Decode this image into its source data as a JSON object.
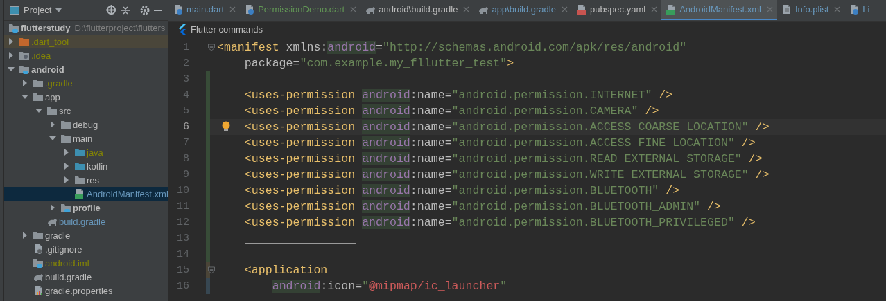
{
  "project_panel": {
    "title": "Project",
    "root": {
      "name": "flutterstudy",
      "path": "D:\\flutterproject\\flutters"
    },
    "tree": [
      {
        "name": ".dart_tool",
        "kind": "excluded-folder",
        "color": "#848504",
        "expanded": false,
        "excluded": true
      },
      {
        "name": ".idea",
        "kind": "idea-folder",
        "color": "#848504",
        "expanded": false,
        "excluded": false
      },
      {
        "name": "android",
        "kind": "module-folder",
        "color": "#bbbbbb",
        "bold": true,
        "expanded": true,
        "children": [
          {
            "name": ".gradle",
            "kind": "folder",
            "color": "#848504",
            "expanded": false
          },
          {
            "name": "app",
            "kind": "folder",
            "color": "#bbbbbb",
            "expanded": true,
            "children": [
              {
                "name": "src",
                "kind": "folder",
                "color": "#bbbbbb",
                "expanded": true,
                "children": [
                  {
                    "name": "debug",
                    "kind": "folder",
                    "color": "#bbbbbb",
                    "expanded": false
                  },
                  {
                    "name": "main",
                    "kind": "folder",
                    "color": "#bbbbbb",
                    "expanded": true,
                    "children": [
                      {
                        "name": "java",
                        "kind": "source-folder",
                        "color": "#848504",
                        "expanded": false
                      },
                      {
                        "name": "kotlin",
                        "kind": "source-folder",
                        "color": "#bbbbbb",
                        "expanded": false
                      },
                      {
                        "name": "res",
                        "kind": "folder",
                        "color": "#bbbbbb",
                        "expanded": false
                      },
                      {
                        "name": "AndroidManifest.xml",
                        "kind": "manifest",
                        "color": "#6897bb",
                        "selected": true
                      }
                    ]
                  },
                  {
                    "name": "profile",
                    "kind": "module-folder",
                    "color": "#bbbbbb",
                    "bold": true,
                    "expanded": false
                  }
                ]
              },
              {
                "name": "build.gradle",
                "kind": "gradle",
                "color": "#6897bb",
                "selected": false
              }
            ]
          },
          {
            "name": "gradle",
            "kind": "folder",
            "color": "#bbbbbb",
            "expanded": false
          },
          {
            "name": ".gitignore",
            "kind": "gitignore",
            "color": "#bbbbbb",
            "selected": false
          },
          {
            "name": "android.iml",
            "kind": "iml",
            "color": "#848504",
            "selected": false
          },
          {
            "name": "build.gradle",
            "kind": "gradle",
            "color": "#bbbbbb",
            "selected": false
          },
          {
            "name": "gradle.properties",
            "kind": "properties",
            "color": "#bbbbbb",
            "selected": false
          }
        ]
      }
    ]
  },
  "tabs": [
    {
      "label": "main.dart",
      "kind": "dart",
      "color": "#6897bb",
      "selected": false,
      "closable": true
    },
    {
      "label": "PermissionDemo.dart",
      "kind": "dart",
      "color": "#629755",
      "selected": false,
      "closable": true
    },
    {
      "label": "android\\build.gradle",
      "kind": "gradle",
      "color": "#bbbbbb",
      "selected": false,
      "closable": true
    },
    {
      "label": "app\\build.gradle",
      "kind": "gradle",
      "color": "#6897bb",
      "selected": false,
      "closable": true
    },
    {
      "label": "pubspec.yaml",
      "kind": "yaml",
      "color": "#bbbbbb",
      "selected": false,
      "closable": true
    },
    {
      "label": "AndroidManifest.xml",
      "kind": "manifest",
      "color": "#6897bb",
      "selected": true,
      "closable": true
    },
    {
      "label": "Info.plist",
      "kind": "plist",
      "color": "#6897bb",
      "selected": false,
      "closable": true
    },
    {
      "label": "Li",
      "kind": "dart",
      "color": "#6897bb",
      "selected": false,
      "closable": false
    }
  ],
  "editor_toolbar": {
    "label": "Flutter commands"
  },
  "code_lines": [
    {
      "number": "1",
      "fold": true,
      "tokens": [
        {
          "kind": "tag",
          "text": "<manifest "
        },
        {
          "kind": "attr",
          "text": "xmlns:"
        },
        {
          "kind": "ns",
          "text": "android"
        },
        {
          "kind": "attr",
          "text": "="
        },
        {
          "kind": "value",
          "text": "\"http://schemas.android.com/apk/res/android\""
        }
      ]
    },
    {
      "number": "2",
      "tokens": [
        {
          "kind": "attr",
          "text": "    package="
        },
        {
          "kind": "value",
          "text": "\"com.example.my_fllutter_test\""
        },
        {
          "kind": "tag",
          "text": ">"
        }
      ]
    },
    {
      "number": "3",
      "color": "#384c38"
    },
    {
      "number": "4",
      "color": "#384c38",
      "tokens": [
        {
          "kind": "tag",
          "text": "    <uses-permission "
        },
        {
          "kind": "ns",
          "text": "android"
        },
        {
          "kind": "attr",
          "text": ":name="
        },
        {
          "kind": "value",
          "text": "\"android.permission.INTERNET\""
        },
        {
          "kind": "tag",
          "text": " />"
        }
      ]
    },
    {
      "number": "5",
      "color": "#384c38",
      "tokens": [
        {
          "kind": "tag",
          "text": "    <uses-permission "
        },
        {
          "kind": "ns",
          "text": "android"
        },
        {
          "kind": "attr",
          "text": ":name="
        },
        {
          "kind": "value",
          "text": "\"android.permission.CAMERA\""
        },
        {
          "kind": "tag",
          "text": " />"
        }
      ]
    },
    {
      "number": "6",
      "color": "#384c38",
      "current": true,
      "bulb": true,
      "tokens": [
        {
          "kind": "tag",
          "text": "    <uses-permission "
        },
        {
          "kind": "ns",
          "text": "android"
        },
        {
          "kind": "attr",
          "text": ":name="
        },
        {
          "kind": "value",
          "text": "\"android.permission.ACCESS_COARSE_LOCATION\""
        },
        {
          "kind": "tag",
          "text": " />"
        }
      ]
    },
    {
      "number": "7",
      "color": "#384c38",
      "tokens": [
        {
          "kind": "tag",
          "text": "    <uses-permission "
        },
        {
          "kind": "ns",
          "text": "android"
        },
        {
          "kind": "attr",
          "text": ":name="
        },
        {
          "kind": "value",
          "text": "\"android.permission.ACCESS_FINE_LOCATION\""
        },
        {
          "kind": "tag",
          "text": " />"
        }
      ]
    },
    {
      "number": "8",
      "color": "#384c38",
      "tokens": [
        {
          "kind": "tag",
          "text": "    <uses-permission "
        },
        {
          "kind": "ns",
          "text": "android"
        },
        {
          "kind": "attr",
          "text": ":name="
        },
        {
          "kind": "value",
          "text": "\"android.permission.READ_EXTERNAL_STORAGE\""
        },
        {
          "kind": "tag",
          "text": " />"
        }
      ]
    },
    {
      "number": "9",
      "color": "#384c38",
      "tokens": [
        {
          "kind": "tag",
          "text": "    <uses-permission "
        },
        {
          "kind": "ns",
          "text": "android"
        },
        {
          "kind": "attr",
          "text": ":name="
        },
        {
          "kind": "value",
          "text": "\"android.permission.WRITE_EXTERNAL_STORAGE\""
        },
        {
          "kind": "tag",
          "text": " />"
        }
      ]
    },
    {
      "number": "10",
      "color": "#384c38",
      "tokens": [
        {
          "kind": "tag",
          "text": "    <uses-permission "
        },
        {
          "kind": "ns",
          "text": "android"
        },
        {
          "kind": "attr",
          "text": ":name="
        },
        {
          "kind": "value",
          "text": "\"android.permission.BLUETOOTH\""
        },
        {
          "kind": "tag",
          "text": " />"
        }
      ]
    },
    {
      "number": "11",
      "color": "#384c38",
      "tokens": [
        {
          "kind": "tag",
          "text": "    <uses-permission "
        },
        {
          "kind": "ns",
          "text": "android"
        },
        {
          "kind": "attr",
          "text": ":name="
        },
        {
          "kind": "value",
          "text": "\"android.permission.BLUETOOTH_ADMIN\""
        },
        {
          "kind": "tag",
          "text": " />"
        }
      ]
    },
    {
      "number": "12",
      "color": "#384c38",
      "tokens": [
        {
          "kind": "tag",
          "text": "    <uses-permission "
        },
        {
          "kind": "ns",
          "text": "android"
        },
        {
          "kind": "attr",
          "text": ":name="
        },
        {
          "kind": "value",
          "text": "\"android.permission.BLUETOOTH_PRIVILEGED\""
        },
        {
          "kind": "tag",
          "text": " />"
        }
      ]
    },
    {
      "number": "13",
      "color": "#384c38",
      "separator": true
    },
    {
      "number": "14",
      "color": "#384c38"
    },
    {
      "number": "15",
      "color": "#4b4538",
      "fold": true,
      "tokens": [
        {
          "kind": "tag",
          "text": "    <application"
        }
      ]
    },
    {
      "number": "16",
      "color": "#374752",
      "tokens": [
        {
          "kind": "ns",
          "text": "        android"
        },
        {
          "kind": "attr",
          "text": ":icon="
        },
        {
          "kind": "value",
          "text": "\""
        },
        {
          "kind": "error",
          "text": "@mipmap/ic_launcher"
        },
        {
          "kind": "value",
          "text": "\""
        }
      ]
    }
  ]
}
